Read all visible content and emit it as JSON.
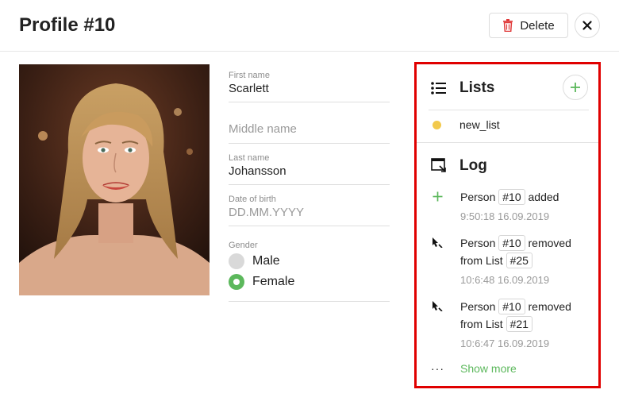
{
  "header": {
    "title": "Profile #10",
    "delete_label": "Delete",
    "delete_icon": "trash-icon",
    "close_icon": "close-icon"
  },
  "photo": {
    "subject": "profile-photo"
  },
  "form": {
    "first_name": {
      "label": "First name",
      "value": "Scarlett"
    },
    "middle_name": {
      "placeholder": "Middle name"
    },
    "last_name": {
      "label": "Last name",
      "value": "Johansson"
    },
    "dob": {
      "label": "Date of birth",
      "placeholder": "DD.MM.YYYY"
    },
    "gender": {
      "label": "Gender",
      "options": [
        "Male",
        "Female"
      ],
      "selected": "Female"
    }
  },
  "lists": {
    "title": "Lists",
    "items": [
      {
        "name": "new_list",
        "color": "#f2c94c"
      }
    ]
  },
  "log": {
    "title": "Log",
    "entries": [
      {
        "icon": "plus-icon",
        "pre": "Person",
        "tag": "#10",
        "post": "added",
        "time": "9:50:18 16.09.2019"
      },
      {
        "icon": "cursor-remove-icon",
        "pre": "Person",
        "tag": "#10",
        "post": "removed",
        "pre2": "from List",
        "tag2": "#25",
        "time": "10:6:48 16.09.2019"
      },
      {
        "icon": "cursor-remove-icon",
        "pre": "Person",
        "tag": "#10",
        "post": "removed",
        "pre2": "from List",
        "tag2": "#21",
        "time": "10:6:47 16.09.2019"
      }
    ],
    "show_more": "Show more",
    "more_glyph": "···"
  },
  "colors": {
    "accent": "#5cb85c",
    "delete": "#e03a3a",
    "highlight": "#e00000",
    "list_dot": "#f2c94c"
  }
}
